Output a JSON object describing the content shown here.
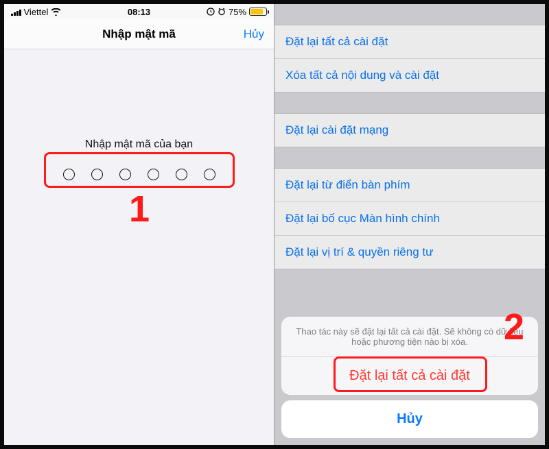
{
  "statusbar": {
    "carrier": "Viettel",
    "time": "08:13",
    "battery_pct": "75%"
  },
  "left": {
    "nav_title": "Nhập mật mã",
    "cancel_label": "Hủy",
    "prompt": "Nhập mật mã của bạn"
  },
  "right": {
    "group1": [
      "Đặt lại tất cả cài đặt",
      "Xóa tất cả nội dung và cài đặt"
    ],
    "group2": [
      "Đặt lại cài đặt mạng"
    ],
    "group3": [
      "Đặt lại từ điển bàn phím",
      "Đặt lại bố cục Màn hình chính",
      "Đặt lại vị trí & quyền riêng tư"
    ],
    "sheet": {
      "message": "Thao tác này sẽ đặt lại tất cả cài đặt. Sẽ không có dữ liệu hoặc phương tiện nào bị xóa.",
      "action": "Đặt lại tất cả cài đặt",
      "cancel": "Hủy"
    }
  },
  "annotations": {
    "label1": "1",
    "label2": "2"
  }
}
